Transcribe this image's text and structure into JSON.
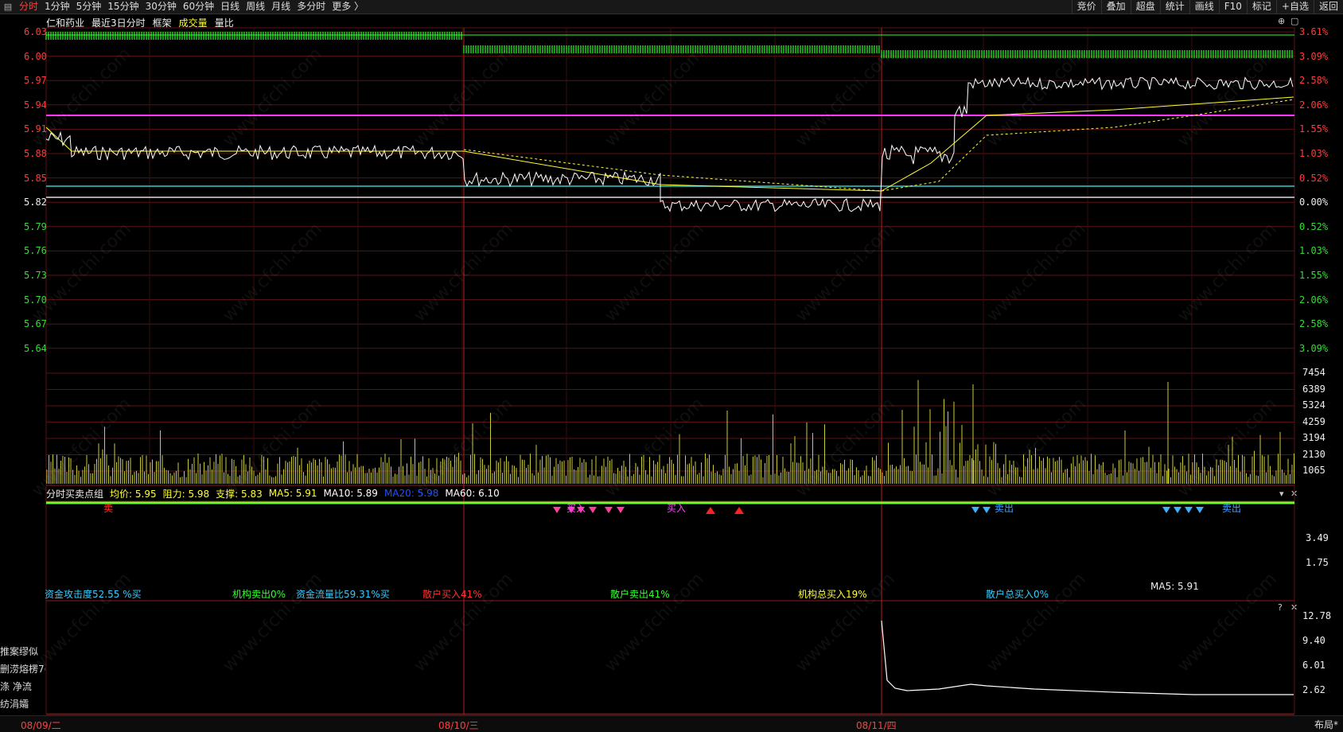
{
  "topbar": {
    "tabs": [
      "分时",
      "1分钟",
      "5分钟",
      "15分钟",
      "30分钟",
      "60分钟",
      "日线",
      "周线",
      "月线",
      "多分时",
      "更多 〉"
    ],
    "active_tab": "分时",
    "right_tools": [
      "竞价",
      "叠加",
      "超盘",
      "统计",
      "画线",
      "F10",
      "标记",
      "+自选",
      "返回"
    ]
  },
  "header": {
    "stock_name": "仁和药业",
    "period": "最近3日分时",
    "frame": "框架",
    "volume_label": "成交量",
    "ratio_label": "量比"
  },
  "price_axis": {
    "left": [
      {
        "v": "6.03",
        "c": "red"
      },
      {
        "v": "6.00",
        "c": "red"
      },
      {
        "v": "5.97",
        "c": "red"
      },
      {
        "v": "5.94",
        "c": "red"
      },
      {
        "v": "5.91",
        "c": "red"
      },
      {
        "v": "5.88",
        "c": "red"
      },
      {
        "v": "5.85",
        "c": "red"
      },
      {
        "v": "5.82",
        "c": "white"
      },
      {
        "v": "5.79",
        "c": "green"
      },
      {
        "v": "5.76",
        "c": "green"
      },
      {
        "v": "5.73",
        "c": "green"
      },
      {
        "v": "5.70",
        "c": "green"
      },
      {
        "v": "5.67",
        "c": "green"
      },
      {
        "v": "5.64",
        "c": "green"
      }
    ],
    "right": [
      {
        "v": "3.61%",
        "c": "red"
      },
      {
        "v": "3.09%",
        "c": "red"
      },
      {
        "v": "2.58%",
        "c": "red"
      },
      {
        "v": "2.06%",
        "c": "red"
      },
      {
        "v": "1.55%",
        "c": "red"
      },
      {
        "v": "1.03%",
        "c": "red"
      },
      {
        "v": "0.52%",
        "c": "red"
      },
      {
        "v": "0.00%",
        "c": "white"
      },
      {
        "v": "0.52%",
        "c": "green"
      },
      {
        "v": "1.03%",
        "c": "green"
      },
      {
        "v": "1.55%",
        "c": "green"
      },
      {
        "v": "2.06%",
        "c": "green"
      },
      {
        "v": "2.58%",
        "c": "green"
      },
      {
        "v": "3.09%",
        "c": "green"
      }
    ]
  },
  "volume_axis": [
    "7454",
    "6389",
    "5324",
    "4259",
    "3194",
    "2130",
    "1065"
  ],
  "indicator": {
    "name": "分时买卖点组",
    "items": [
      {
        "label": "均价: 5.95",
        "color": "#ffff33"
      },
      {
        "label": "阻力: 5.98",
        "color": "#ffff33"
      },
      {
        "label": "支撑: 5.83",
        "color": "#ffff33"
      },
      {
        "label": "MA5: 5.91",
        "color": "#ffff33"
      },
      {
        "label": "MA10: 5.89",
        "color": "#ffffff"
      },
      {
        "label": "MA20: 5.98",
        "color": "#2050ff"
      },
      {
        "label": "MA60: 6.10",
        "color": "#ffffff"
      }
    ],
    "axis": [
      "3.49",
      "1.75"
    ],
    "signals": [
      {
        "text": "卖",
        "color": "#ff3030"
      },
      {
        "text": "买入",
        "color": "#ff40ff"
      },
      {
        "text": "买入",
        "color": "#ff40ff"
      },
      {
        "text": "卖出",
        "color": "#40a0ff"
      },
      {
        "text": "卖出",
        "color": "#40a0ff"
      }
    ],
    "ma_overlay": {
      "ma5": "MA5: 5.91"
    }
  },
  "flow": {
    "labels": [
      {
        "text": "资金攻击度52.55 %买",
        "color": "#33ccff"
      },
      {
        "text": "机构卖出0%",
        "color": "#33ff33"
      },
      {
        "text": "资金流量比59.31%买",
        "color": "#33ccff"
      },
      {
        "text": "散户买入41%",
        "color": "#ff3030"
      },
      {
        "text": "散户卖出41%",
        "color": "#33ff33"
      },
      {
        "text": "机构总买入19%",
        "color": "#ffff33"
      },
      {
        "text": "散户总买入0%",
        "color": "#33ccff"
      }
    ],
    "axis": [
      "12.78",
      "9.40",
      "6.01",
      "2.62"
    ]
  },
  "side_labels": [
    "推案缪似",
    "删涝熔楞7(",
    "涤  净流",
    "纺涓孀"
  ],
  "dates": [
    "08/09/二",
    "08/10/三",
    "08/11/四"
  ],
  "layout_button": "布局*",
  "watermark": "www.cfchi.com",
  "colors": {
    "grid": "#5a1212",
    "price_line": "#ffffff",
    "avg_line": "#ffff33",
    "support": "#33cccc",
    "resist": "#ff33ff",
    "volume": "#cccc33",
    "buy_band": "#22cc22",
    "up": "#ff3b3b",
    "down": "#33dd33"
  }
}
